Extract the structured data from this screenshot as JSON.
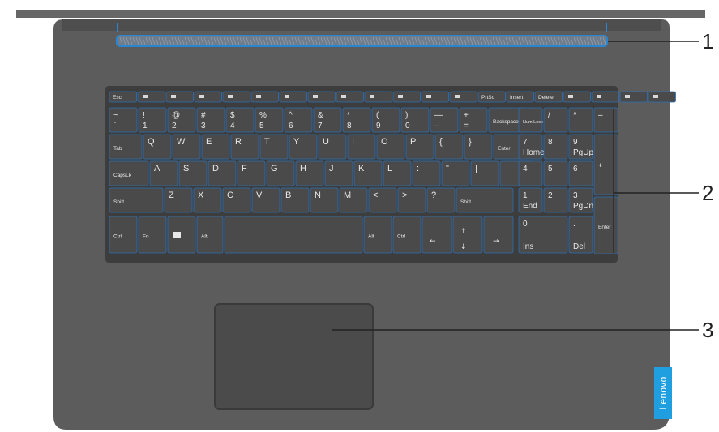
{
  "callouts": [
    "1",
    "2",
    "3"
  ],
  "logo_text": "Lenovo",
  "keyboard": {
    "fn_row": [
      "Esc",
      "",
      "",
      "",
      "",
      "",
      "",
      "",
      "",
      "",
      "",
      "",
      "",
      "PrtSc",
      "Insert",
      "Delete",
      "",
      "",
      "",
      ""
    ],
    "row1": [
      {
        "top": "~",
        "bottom": "`"
      },
      {
        "top": "!",
        "bottom": "1"
      },
      {
        "top": "@",
        "bottom": "2"
      },
      {
        "top": "#",
        "bottom": "3"
      },
      {
        "top": "$",
        "bottom": "4"
      },
      {
        "top": "%",
        "bottom": "5"
      },
      {
        "top": "^",
        "bottom": "6"
      },
      {
        "top": "&",
        "bottom": "7"
      },
      {
        "top": "*",
        "bottom": "8"
      },
      {
        "top": "(",
        "bottom": "9"
      },
      {
        "top": ")",
        "bottom": "0"
      },
      {
        "top": "—",
        "bottom": "–"
      },
      {
        "top": "+",
        "bottom": "="
      },
      {
        "top": "Backspace",
        "bottom": ""
      }
    ],
    "row2": [
      "Tab",
      "Q",
      "W",
      "E",
      "R",
      "T",
      "Y",
      "U",
      "I",
      "O",
      "P",
      "{",
      "}",
      "Enter"
    ],
    "row3": [
      "CapsLk",
      "A",
      "S",
      "D",
      "F",
      "G",
      "H",
      "J",
      "K",
      "L",
      ":",
      "\"",
      "|"
    ],
    "row4": [
      "Shift",
      "Z",
      "X",
      "C",
      "V",
      "B",
      "N",
      "M",
      "<",
      ">",
      "?",
      "Shift"
    ],
    "row5": [
      "Ctrl",
      "Fn",
      "",
      "Alt",
      "",
      "Alt",
      "Ctrl",
      "",
      "",
      "",
      ""
    ],
    "numpad": {
      "row0": [
        "Num Lock",
        "/",
        "*",
        "–"
      ],
      "row1": [
        {
          "top": "7",
          "sub": "Home"
        },
        {
          "top": "8",
          "sub": ""
        },
        {
          "top": "9",
          "sub": "PgUp"
        }
      ],
      "plus": "+",
      "row2": [
        {
          "top": "4",
          "sub": ""
        },
        {
          "top": "5",
          "sub": ""
        },
        {
          "top": "6",
          "sub": ""
        }
      ],
      "row3": [
        {
          "top": "1",
          "sub": "End"
        },
        {
          "top": "2",
          "sub": ""
        },
        {
          "top": "3",
          "sub": "PgDn"
        }
      ],
      "enter": "Enter",
      "zero": {
        "top": "0",
        "sub": "Ins"
      },
      "dot": {
        "top": ".",
        "sub": "Del"
      }
    }
  },
  "colors": {
    "chassis": "#5c5c5c",
    "key": "#4a4a4a",
    "key_edge": "#2e6fb5",
    "accent": "#1f9fe0",
    "callout_line": "#222222"
  }
}
